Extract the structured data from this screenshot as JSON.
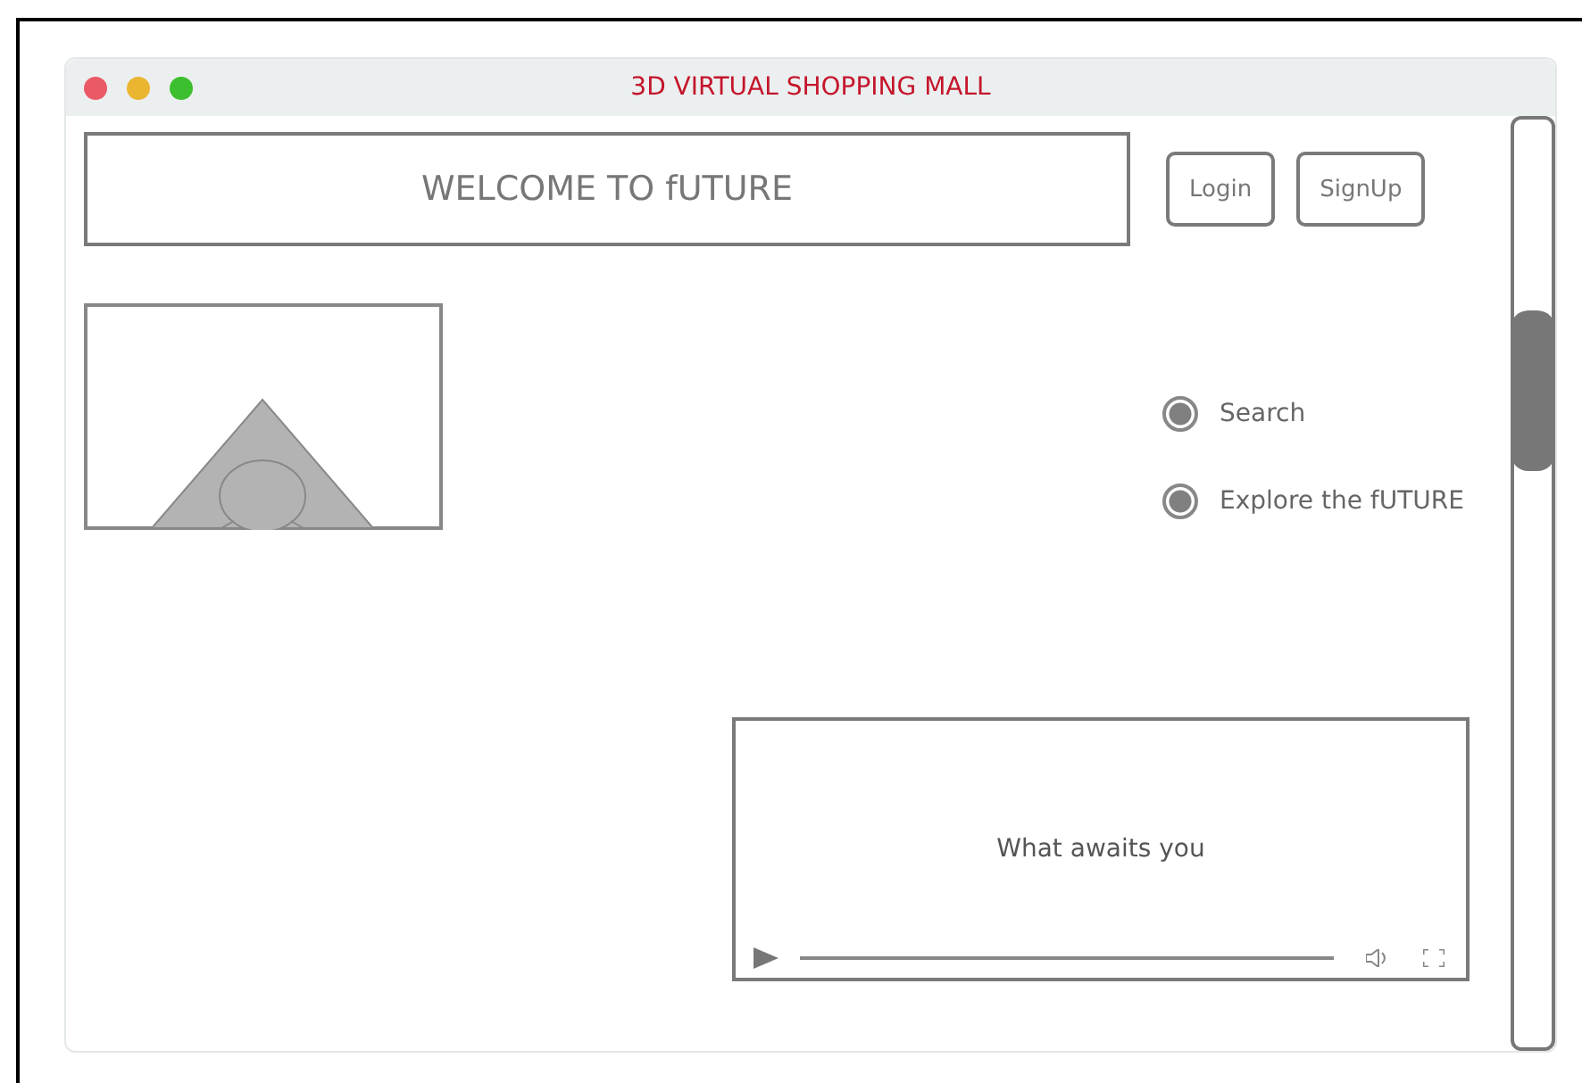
{
  "window": {
    "title": "3D VIRTUAL SHOPPING MALL"
  },
  "header": {
    "banner": "WELCOME TO fUTURE",
    "buttons": [
      "Login",
      "SignUp"
    ]
  },
  "options": [
    {
      "label": "Search",
      "selected": true
    },
    {
      "label": "Explore the fUTURE",
      "selected": true
    }
  ],
  "video": {
    "caption": "What awaits you"
  }
}
